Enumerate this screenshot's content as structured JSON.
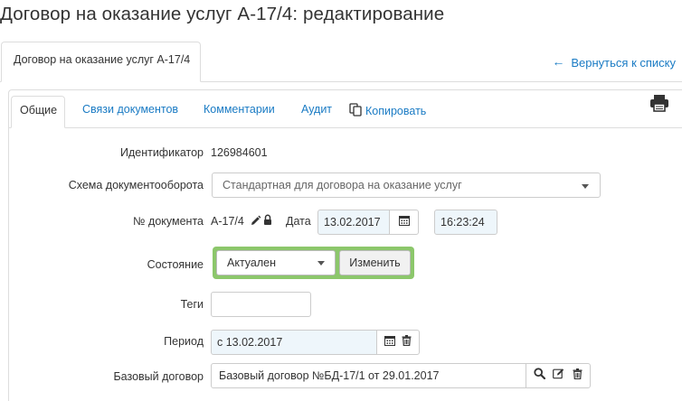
{
  "page": {
    "title": "Договор на оказание услуг А-17/4: редактирование"
  },
  "outer_tabs": {
    "main_label": "Договор на оказание услуг А-17/4",
    "back_label": "Вернуться к списку"
  },
  "inner_tabs": {
    "general": "Общие",
    "links": "Связи документов",
    "comments": "Комментарии",
    "audit": "Аудит",
    "copy": "Копировать"
  },
  "form": {
    "identifier_label": "Идентификатор",
    "identifier_value": "126984601",
    "schema_label": "Схема документооборота",
    "schema_value": "Стандартная для договора на оказание услуг",
    "docnum_label": "№ документа",
    "docnum_value": "А-17/4",
    "date_label": "Дата",
    "date_value": "13.02.2017",
    "time_value": "16:23:24",
    "state_label": "Состояние",
    "state_value": "Актуален",
    "state_button": "Изменить",
    "tags_label": "Теги",
    "tags_value": "",
    "period_label": "Период",
    "period_value": "с 13.02.2017",
    "base_label": "Базовый договор",
    "base_value": "Базовый договор №БД-17/1 от 29.01.2017"
  },
  "colors": {
    "link": "#1a7bc4",
    "state_highlight": "#8cc76b",
    "input_highlight": "#eef6fb"
  },
  "icons": [
    "arrow-left-icon",
    "copy-icon",
    "printer-icon",
    "pencil-icon",
    "lock-icon",
    "calendar-icon",
    "trash-icon",
    "search-icon",
    "edit-icon",
    "caret-down-icon"
  ]
}
